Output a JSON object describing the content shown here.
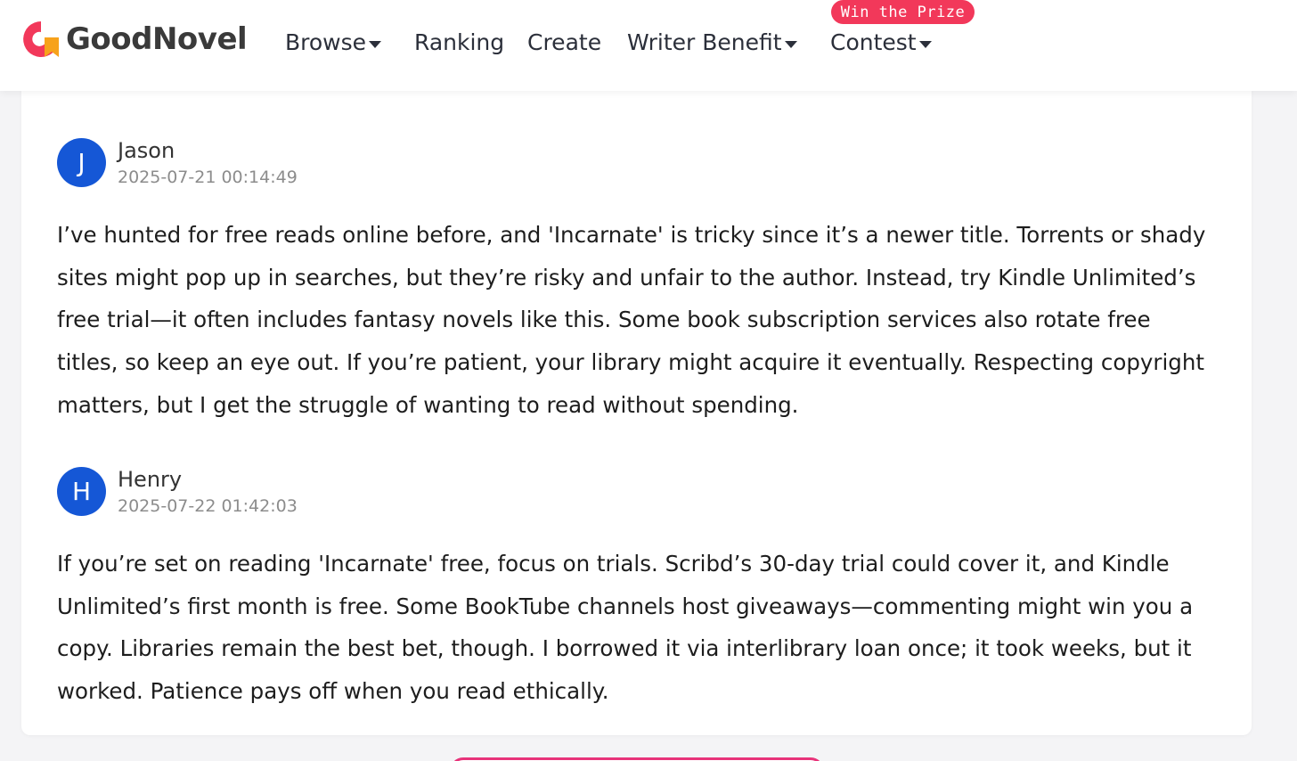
{
  "header": {
    "logo_text": "GoodNovel",
    "nav": [
      {
        "label": "Browse",
        "has_dropdown": true
      },
      {
        "label": "Ranking",
        "has_dropdown": false
      },
      {
        "label": "Create",
        "has_dropdown": false
      },
      {
        "label": "Writer Benefit",
        "has_dropdown": true
      },
      {
        "label": "Contest",
        "has_dropdown": true
      }
    ],
    "badge": "Win the Prize",
    "brand_colors": {
      "logo_red": "#f2385a",
      "logo_orange": "#f7a21b",
      "badge": "#f2385a"
    }
  },
  "comments": [
    {
      "initial": "J",
      "name": "Jason",
      "timestamp": "2025-07-21 00:14:49",
      "text": "I’ve hunted for free reads online before, and 'Incarnate' is tricky since it’s a newer title. Torrents or shady sites might pop up in searches, but they’re risky and unfair to the author. Instead, try Kindle Unlimited’s free trial—it often includes fantasy novels like this. Some book subscription services also rotate free titles, so keep an eye out. If you’re patient, your library might acquire it eventually. Respecting copyright matters, but I get the struggle of wanting to read without spending."
    },
    {
      "initial": "H",
      "name": "Henry",
      "timestamp": "2025-07-22 01:42:03",
      "text": "If you’re set on reading 'Incarnate' free, focus on trials. Scribd’s 30-day trial could cover it, and Kindle Unlimited’s first month is free. Some BookTube channels host giveaways—commenting might win you a copy. Libraries remain the best bet, though. I borrowed it via interlibrary loan once; it took weeks, but it worked. Patience pays off when you read ethically."
    }
  ],
  "avatar_color": "#1557d6"
}
